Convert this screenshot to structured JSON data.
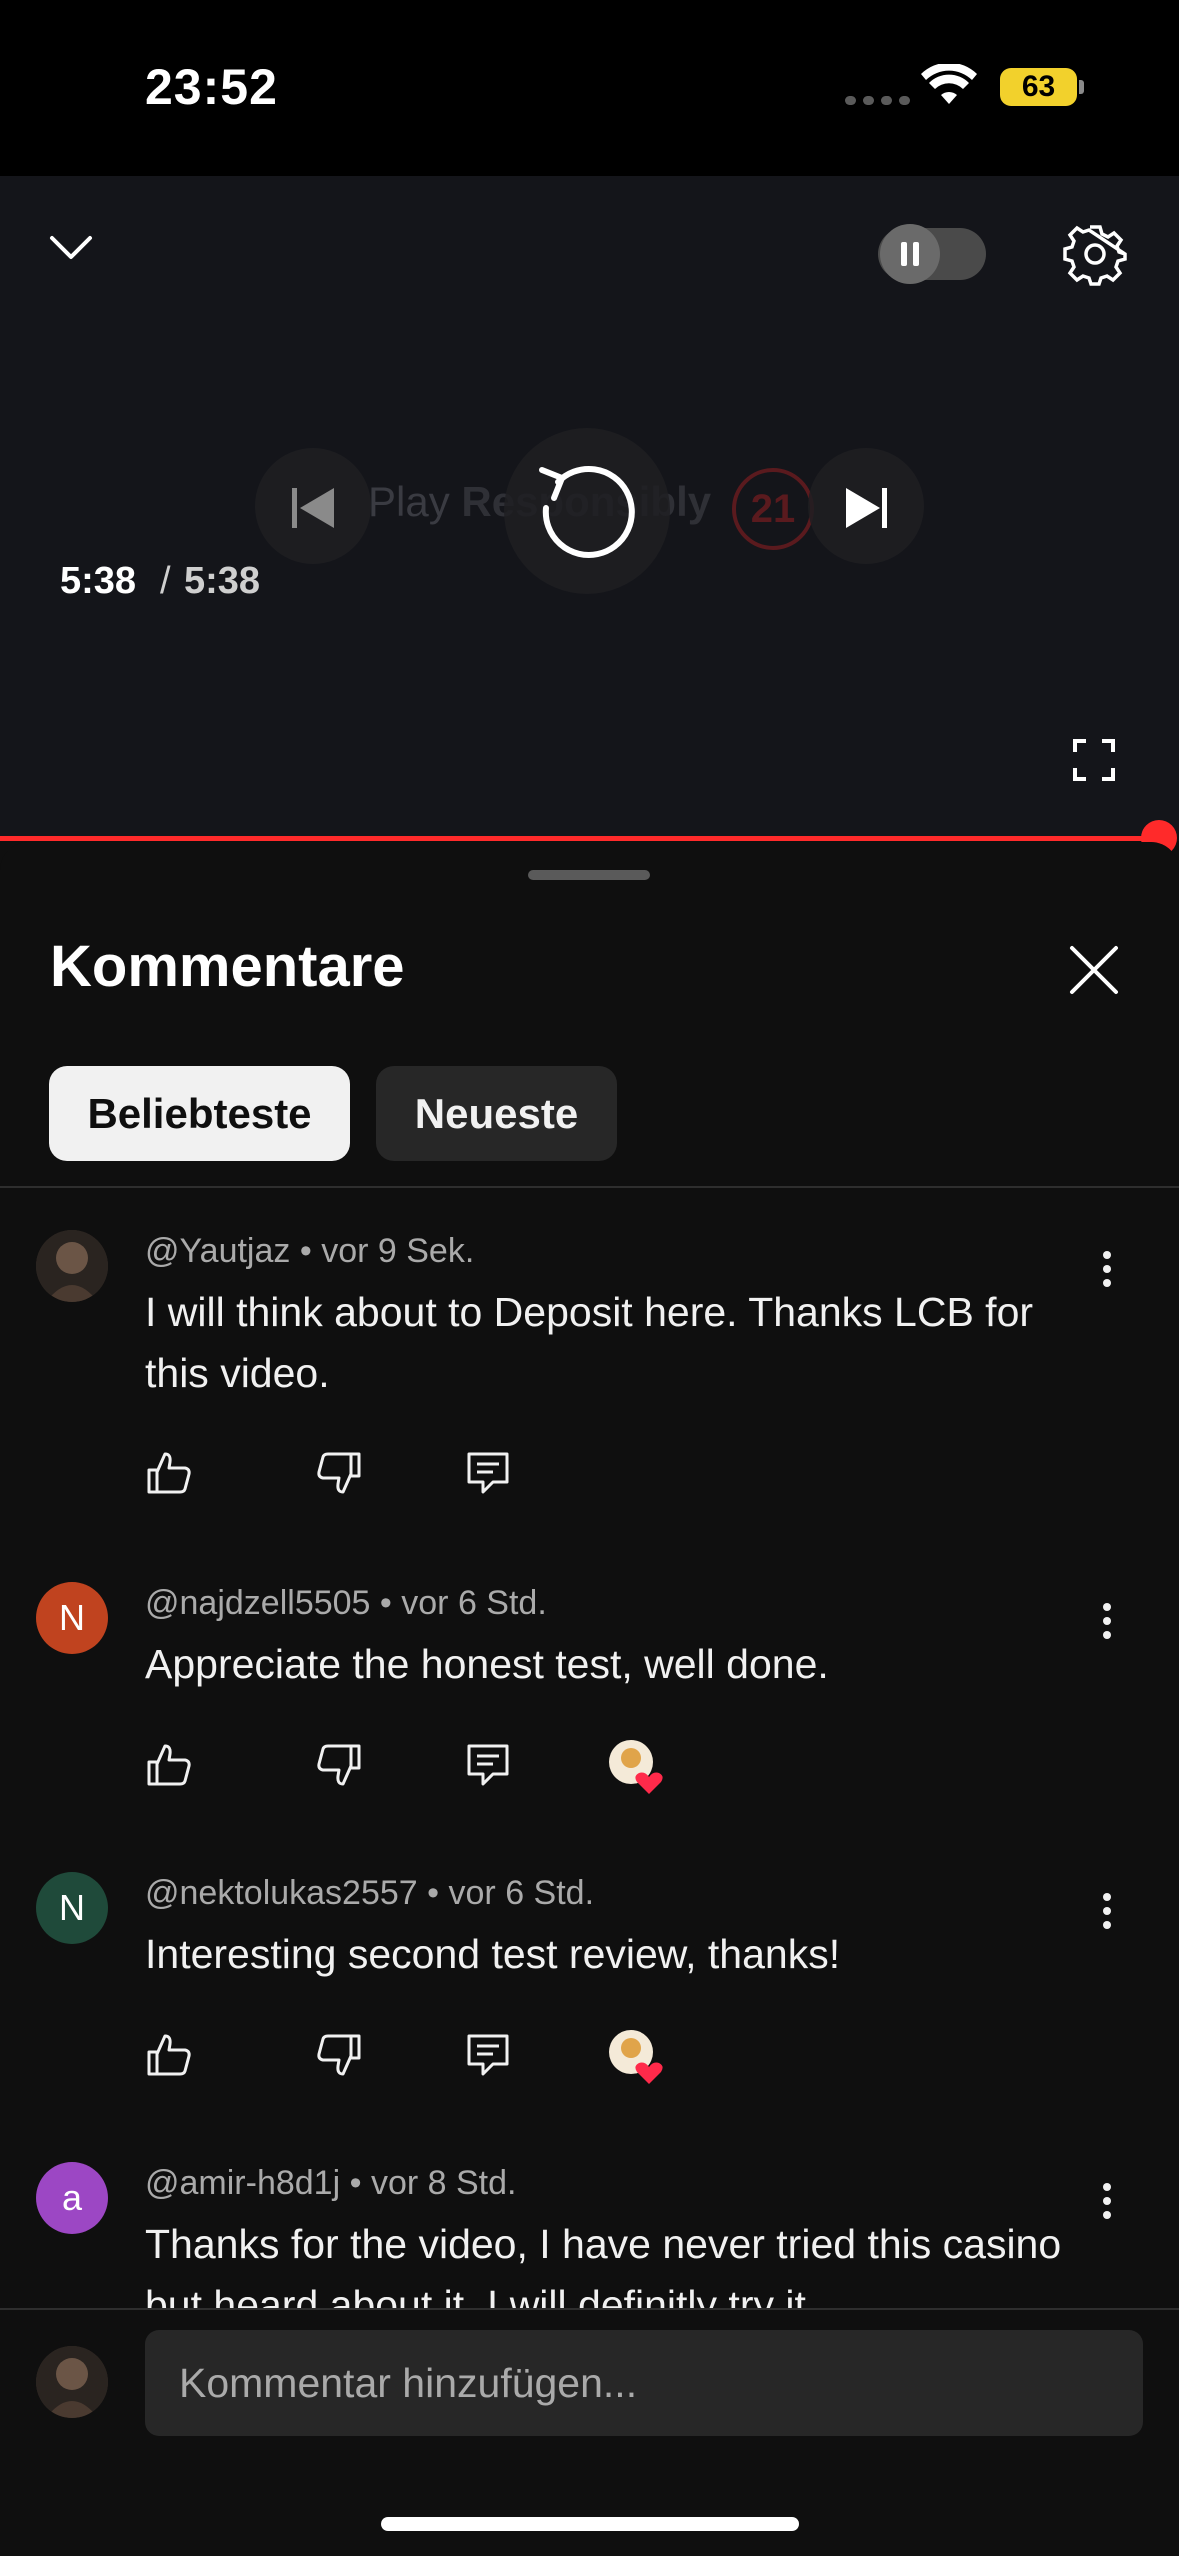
{
  "status_bar": {
    "time": "23:52",
    "battery": "63",
    "icons": [
      "signal-dots-icon",
      "wifi-icon",
      "battery-icon"
    ]
  },
  "player": {
    "time_current": "5:38",
    "time_separator": "/",
    "time_total": "5:38",
    "progress_fraction": 1.0,
    "watermark_text_prefix": "Play ",
    "watermark_text_bold": "Responsibly",
    "watermark_badge": "21",
    "accent_color": "#ff2a2a",
    "icons": [
      "chevron-down-icon",
      "autoplay-toggle",
      "settings-gear-icon",
      "previous-icon",
      "replay-icon",
      "next-icon",
      "fullscreen-icon"
    ]
  },
  "comments_sheet": {
    "title": "Kommentare",
    "chips": [
      {
        "label": "Beliebteste",
        "selected": true
      },
      {
        "label": "Neueste",
        "selected": false
      }
    ],
    "comments": [
      {
        "author": "@Yautjaz",
        "time": "vor 9 Sek.",
        "text": "I will think about to Deposit here. Thanks LCB for this video.",
        "avatar_letter": "",
        "avatar_color": "#3a2f28",
        "creator_heart": false
      },
      {
        "author": "@najdzell5505",
        "time": "vor 6 Std.",
        "text": "Appreciate the honest test, well done.",
        "avatar_letter": "N",
        "avatar_color": "#c0431f",
        "creator_heart": true
      },
      {
        "author": "@nektolukas2557",
        "time": "vor 6 Std.",
        "text": "Interesting second test review, thanks!",
        "avatar_letter": "N",
        "avatar_color": "#1f4a3a",
        "creator_heart": true
      },
      {
        "author": "@amir-h8d1j",
        "time": "vor 8 Std.",
        "text": "Thanks for the video, I have never tried this casino but heard about it. I will definitly try it",
        "avatar_letter": "a",
        "avatar_color": "#9c47c4",
        "creator_heart": false
      }
    ],
    "meta_separator": "•",
    "composer_placeholder": "Kommentar hinzufügen..."
  }
}
